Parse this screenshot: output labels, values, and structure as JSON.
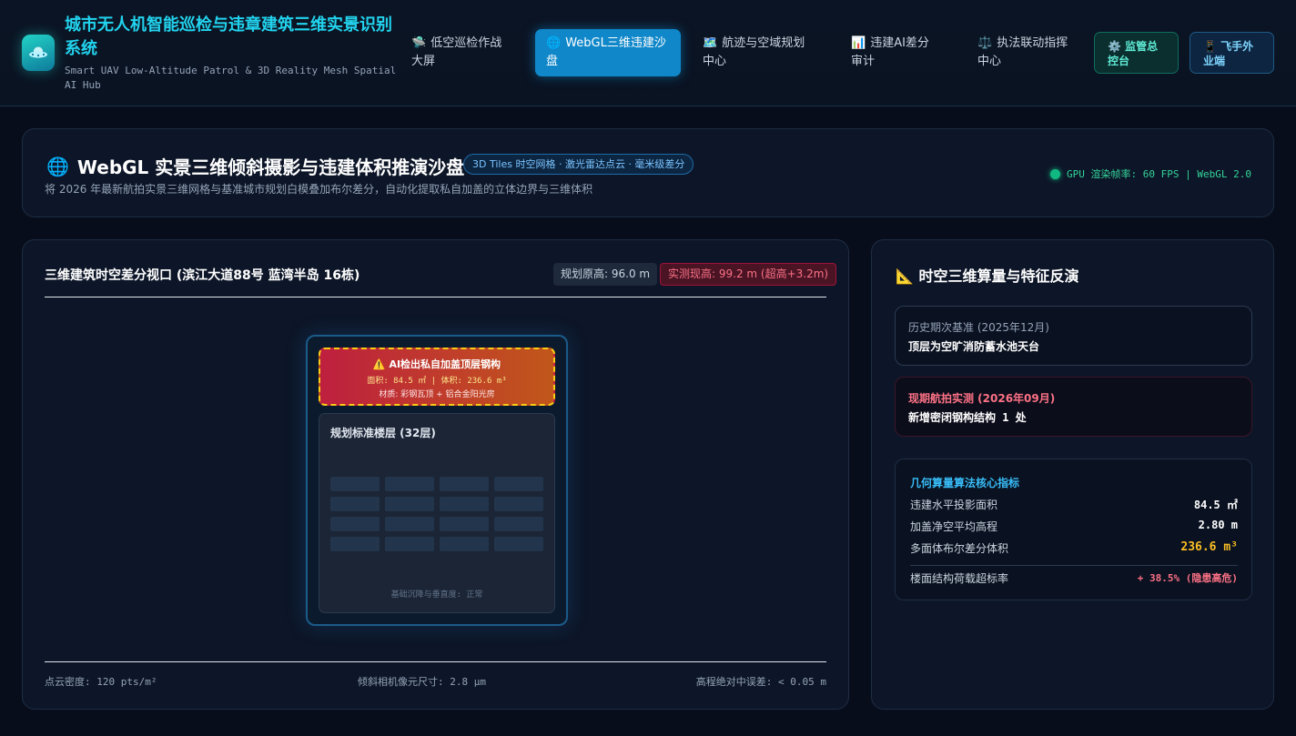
{
  "app": {
    "title": "城市无人机智能巡检与违章建筑三维实景识别系统",
    "subtitle": "Smart UAV Low-Altitude Patrol & 3D Reality Mesh Spatial AI Hub",
    "logo_icon": "ufo-icon"
  },
  "nav": [
    {
      "icon": "🛸",
      "label": "低空巡检作战大屏",
      "active": false
    },
    {
      "icon": "🌐",
      "label": "WebGL三维违建沙盘",
      "active": true
    },
    {
      "icon": "🗺️",
      "label": "航迹与空域规划中心",
      "active": false
    },
    {
      "icon": "📊",
      "label": "违建AI差分审计",
      "active": false
    },
    {
      "icon": "⚖️",
      "label": "执法联动指挥中心",
      "active": false
    }
  ],
  "actions": {
    "console": {
      "icon": "⚙️",
      "label": "监管总控台"
    },
    "pilot": {
      "icon": "📱",
      "label": "飞手外业端"
    }
  },
  "header": {
    "icon": "🌐",
    "title": "WebGL 实景三维倾斜摄影与违建体积推演沙盘",
    "tag": "3D Tiles 时空网格 · 激光雷达点云 · 毫米级差分",
    "description": "将 2026 年最新航拍实景三维网格与基准城市规划白模叠加布尔差分，自动化提取私自加盖的立体边界与三维体积",
    "gpu_status": "GPU 渲染帧率: 60 FPS | WebGL 2.0"
  },
  "viewport": {
    "title": "三维建筑时空差分视口 (滨江大道88号 蓝湾半岛 16栋)",
    "plan_badge": "规划原高: 96.0 m",
    "actual_badge": "实测现高: 99.2 m (超高+3.2m)",
    "alert": {
      "title": "⚠️ AI检出私自加盖顶层钢构",
      "metrics": "面积: 84.5 ㎡ | 体积: 236.6 m³",
      "material": "材质: 彩钢瓦顶 + 铝合金阳光房"
    },
    "floors": {
      "title": "规划标准楼层 (32层)",
      "foot": "基础沉降与垂直度: 正常"
    },
    "stats": {
      "density": "点云密度: 120 pts/m²",
      "pixel": "倾斜相机像元尺寸: 2.8 μm",
      "error": "高程绝对中误差: < 0.05 m"
    }
  },
  "side": {
    "title_icon": "📐",
    "title": "时空三维算量与特征反演",
    "history": {
      "label": "历史期次基准 (2025年12月)",
      "value": "顶层为空旷消防蓄水池天台"
    },
    "current": {
      "label": "现期航拍实测 (2026年09月)",
      "value": "新增密闭钢构结构 1 处"
    },
    "metrics": {
      "title": "几何算量算法核心指标",
      "rows": [
        {
          "label": "违建水平投影面积",
          "value": "84.5 ㎡"
        },
        {
          "label": "加盖净空平均高程",
          "value": "2.80 m"
        },
        {
          "label": "多面体布尔差分体积",
          "value": "236.6 m³"
        },
        {
          "label": "楼面结构荷载超标率",
          "value": "+ 38.5% (隐患高危)"
        }
      ]
    }
  }
}
